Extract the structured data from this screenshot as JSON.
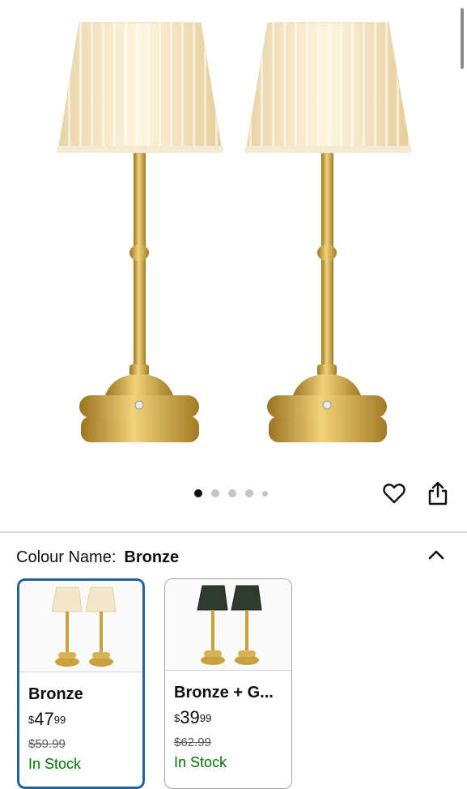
{
  "product": {
    "image_alt": "Pair of bronze table lamps with pleated cream shades",
    "image_dots": [
      true,
      false,
      false,
      false,
      false
    ]
  },
  "actions": {
    "wishlist_icon": "heart-icon",
    "share_icon": "share-icon"
  },
  "variation": {
    "label": "Colour Name:",
    "selected": "Bronze",
    "collapse_icon": "chevron-up-icon"
  },
  "swatches": [
    {
      "name": "Bronze",
      "price_symbol": "$",
      "price_whole": "47",
      "price_fraction": "99",
      "was_price": "$59.99",
      "availability": "In Stock",
      "shade_color": "#f4e6c8",
      "selected": true
    },
    {
      "name": "Bronze + G...",
      "price_symbol": "$",
      "price_whole": "39",
      "price_fraction": "99",
      "was_price": "$62.99",
      "availability": "In Stock",
      "shade_color": "#2f3b2e",
      "selected": false
    }
  ],
  "colors": {
    "selected_border": "#2162a1",
    "in_stock": "#007600",
    "brass": "#c9a13f"
  }
}
